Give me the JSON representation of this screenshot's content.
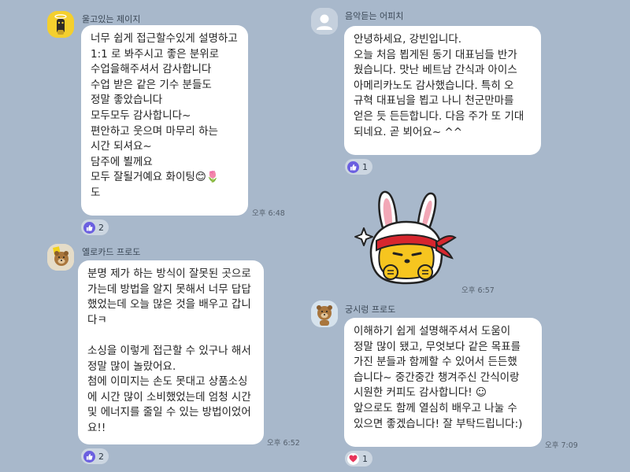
{
  "colors": {
    "background": "#a8b8cb",
    "bubble": "#ffffff",
    "like_reaction": "#6b5fe0",
    "heart_reaction": "#e8345a"
  },
  "left_messages": [
    {
      "sender": "울고있는 제이지",
      "avatar_icon": "jay-g-avatar-icon",
      "text": "너무 쉽게 접근할수있게 설명하고\n1:1 로 봐주시고 좋은 분위로\n수업을해주셔서 감사합니다\n수업 받은 같은 기수 분들도\n정말 좋았습니다\n모두모두 감사합니다~\n편안하고 웃으며 마무리 하는\n시간 되셔요~\n담주에 뵐께요\n모두 잘될거예요 화이팅😊🌷\n도",
      "time": "오후 6:48",
      "reaction": {
        "icon": "thumbs-up-icon",
        "count": "2"
      }
    },
    {
      "sender": "옐로카드 프로도",
      "avatar_icon": "frodo-avatar-icon",
      "text": "분명 제가 하는 방식이 잘못된 곳으로\n가는데 방법을 알지 못해서 너무 답답\n했었는데 오늘 많은 것을 배우고 갑니\n다ㅋ\n\n소싱을 이렇게 접근할 수 있구나 해서\n정말 많이 놀랐어요.\n첨에 이미지는 손도 못대고 상품소싱\n에 시간 많이 소비했었는데 엄청 시간\n및 에너지를 줄일 수 있는 방법이었어\n요!!",
      "time": "오후 6:52",
      "reaction": {
        "icon": "thumbs-up-icon",
        "count": "2"
      }
    }
  ],
  "right_messages": [
    {
      "sender": "음악듣는 어피치",
      "avatar_icon": "default-profile-icon",
      "text": "안녕하세요, 강빈입니다.\n오늘 처음 뵙게된 동기 대표님들 반가\n웠습니다. 맛난 베트남 간식과 아이스\n아메리카노도 감사했습니다. 특히 오\n규혁 대표님을 뵙고 나니 천군만마를\n얻은 듯 든든합니다. 다음 주가 또 기대\n되네요. 곧 뵈어요~ ^^",
      "reaction": {
        "icon": "thumbs-up-icon",
        "count": "1"
      }
    },
    {
      "sticker_icon": "muzi-headband-sticker-icon",
      "time": "오후 6:57"
    },
    {
      "sender": "궁시렁 프로도",
      "avatar_icon": "frodo-avatar-icon",
      "text": "이해하기 쉽게 설명해주셔서 도움이\n정말 많이 됐고, 무엇보다 같은 목표를\n가진 분들과 함께할 수 있어서 든든했\n습니다~ 중간중간 챙겨주신 간식이랑\n시원한 커피도 감사합니다! ☺\n앞으로도 함께 열심히 배우고 나눌 수\n있으면 좋겠습니다! 잘 부탁드립니다:)",
      "time": "오후 7:09",
      "reaction": {
        "icon": "heart-icon",
        "count": "1"
      }
    }
  ]
}
